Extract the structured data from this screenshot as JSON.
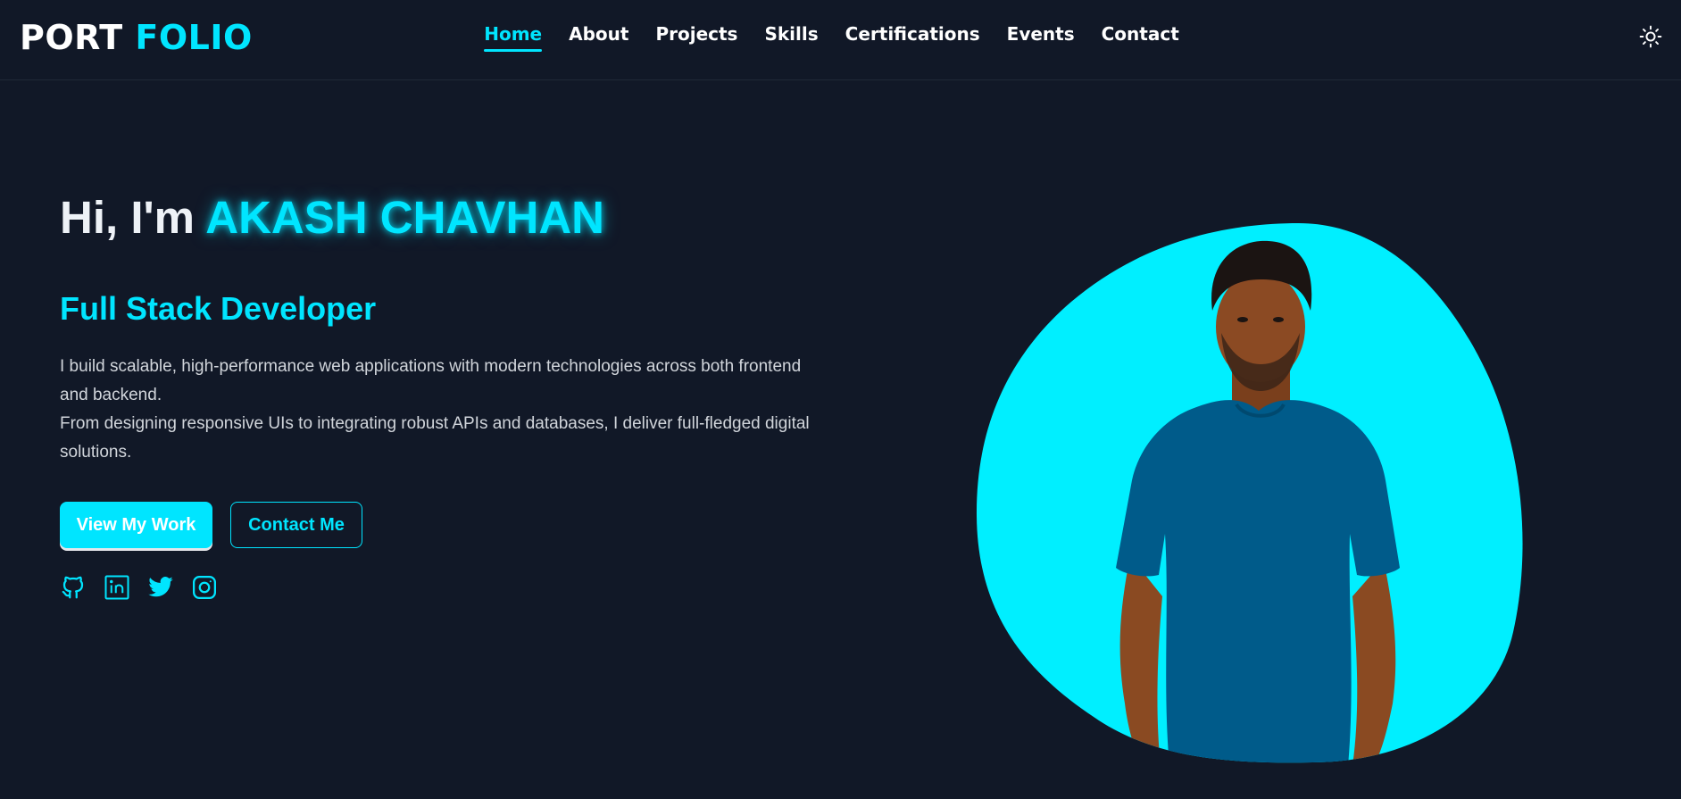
{
  "brand": {
    "part1": "PORT",
    "part2": "FOLIO"
  },
  "nav": {
    "items": [
      {
        "label": "Home",
        "active": true
      },
      {
        "label": "About",
        "active": false
      },
      {
        "label": "Projects",
        "active": false
      },
      {
        "label": "Skills",
        "active": false
      },
      {
        "label": "Certifications",
        "active": false
      },
      {
        "label": "Events",
        "active": false
      },
      {
        "label": "Contact",
        "active": false
      }
    ],
    "theme_toggle_icon": "sun-icon"
  },
  "hero": {
    "greeting": "Hi, I'm",
    "name": "AKASH CHAVHAN",
    "role": "Full Stack Developer",
    "description_line1": "I build scalable, high-performance web applications with modern technologies across both frontend and backend.",
    "description_line2": "From designing responsive UIs to integrating robust APIs and databases, I deliver full-fledged digital solutions.",
    "primary_button": "View My Work",
    "secondary_button": "Contact Me",
    "socials": [
      "github-icon",
      "linkedin-icon",
      "twitter-icon",
      "instagram-icon"
    ]
  },
  "colors": {
    "background": "#111827",
    "accent": "#00e5ff",
    "text": "#ffffff",
    "muted_text": "#d1d5db",
    "shirt": "#005b8a"
  }
}
